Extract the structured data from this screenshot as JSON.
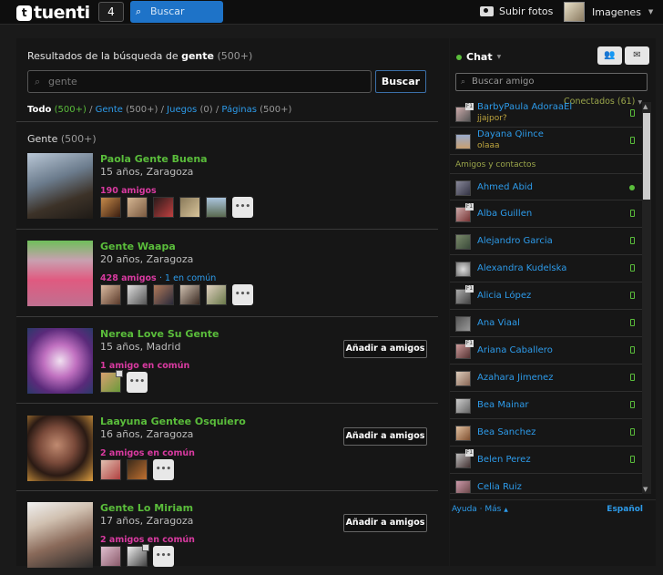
{
  "topbar": {
    "logo": "tuenti",
    "notification_count": "4",
    "search_placeholder": "Buscar",
    "photos_label": "Subir fotos",
    "user_label": "Imagenes"
  },
  "results": {
    "title_prefix": "Resultados de la búsqueda de",
    "query": "gente",
    "count": "(500+)",
    "search_value": "gente",
    "search_button": "Buscar",
    "filters": {
      "all": "Todo",
      "all_count": "(500+)",
      "people": "Gente",
      "people_count": "(500+)",
      "games": "Juegos",
      "games_count": "(0)",
      "pages": "Páginas",
      "pages_count": "(500+)"
    },
    "section_label": "Gente",
    "section_count": "(500+)",
    "more_label": "•••",
    "add_label": "Añadir a amigos",
    "people": [
      {
        "name": "Paola Gente Buena",
        "info": "15 años, Zaragoza",
        "friends": "190 amigos",
        "common": ""
      },
      {
        "name": "Gente Waapa",
        "info": "20 años, Zaragoza",
        "friends": "428 amigos",
        "common": "· 1 en común"
      },
      {
        "name": "Nerea Love Su Gente",
        "info": "15 años, Madrid",
        "friends": "1 amigo en común",
        "common": ""
      },
      {
        "name": "Laayuna Gentee Osquiero",
        "info": "16 años, Zaragoza",
        "friends": "2 amigos en común",
        "common": ""
      },
      {
        "name": "Gente Lo Miriam",
        "info": "17 años, Zaragoza",
        "friends": "2 amigos en común",
        "common": ""
      }
    ]
  },
  "chat": {
    "title": "Chat",
    "search_placeholder": "Buscar amigo",
    "connected": "Conectados (61)",
    "section_label": "Amigos y contactos",
    "online": [
      {
        "name": "BarbyPaula AdoraaEl",
        "status": "jjajpor?"
      },
      {
        "name": "Dayana Qiince",
        "status": "olaaa"
      }
    ],
    "contacts": [
      "Ahmed Abid",
      "Alba Guillen",
      "Alejandro Garcia",
      "Alexandra Kudelska",
      "Alicia López",
      "Ana Viaal",
      "Ariana Caballero",
      "Azahara Jimenez",
      "Bea Mainar",
      "Bea Sanchez",
      "Belen Perez",
      "Celia Ruiz"
    ],
    "footer_help": "Ayuda",
    "footer_more": "Más",
    "footer_language": "Español"
  }
}
